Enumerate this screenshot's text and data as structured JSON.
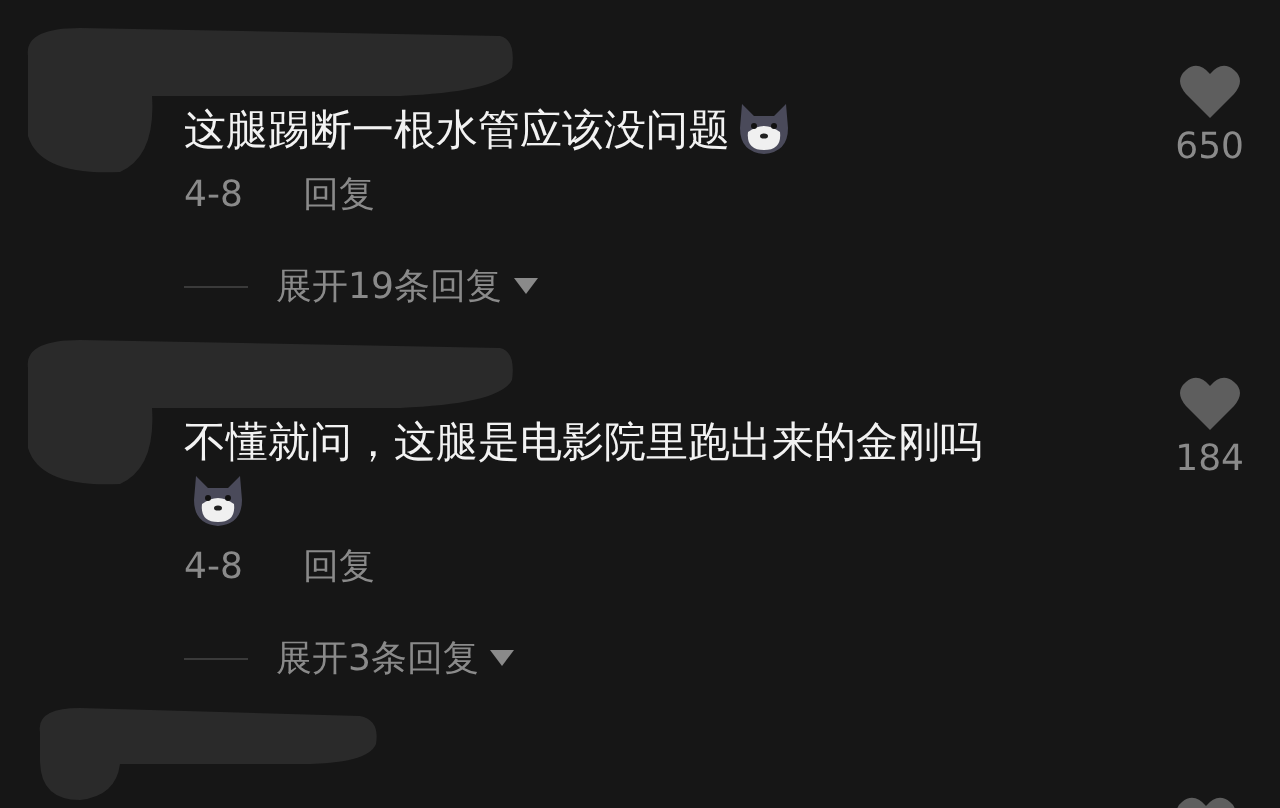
{
  "comments": [
    {
      "text": "这腿踢断一根水管应该没问题",
      "emoji": true,
      "date": "4-8",
      "reply_label": "回复",
      "likes": "650",
      "expand_label": "展开19条回复"
    },
    {
      "text": "不懂就问，这腿是电影院里跑出来的金刚吗",
      "emoji": true,
      "date": "4-8",
      "reply_label": "回复",
      "likes": "184",
      "expand_label": "展开3条回复"
    }
  ]
}
